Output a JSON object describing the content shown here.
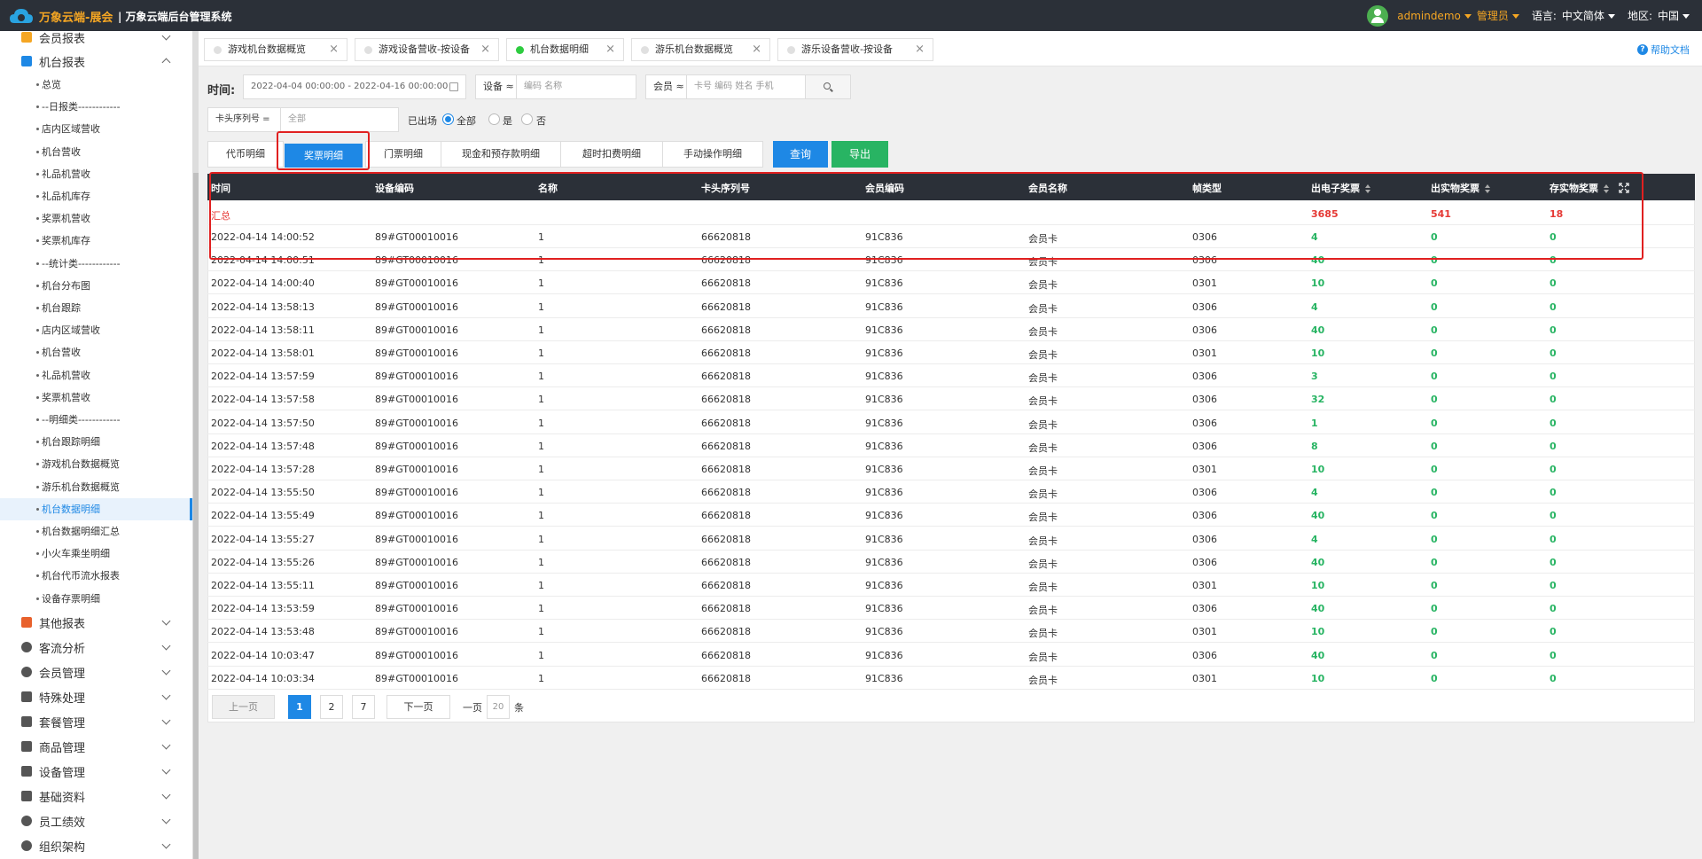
{
  "topbar": {
    "brand": "万象云端-展会",
    "subtitle": "| 万象云端后台管理系统",
    "user": "admindemo",
    "role": "管理员",
    "lang_label": "语言:",
    "lang_value": "中文简体",
    "region_label": "地区:",
    "region_value": "中国"
  },
  "sidebar": {
    "groups_top": [
      {
        "label": "会员报表",
        "icon": "report-icon"
      },
      {
        "label": "机台报表",
        "icon": "machine-report-icon"
      }
    ],
    "items": [
      "总览",
      "--日报类------------",
      "店内区域营收",
      "机台营收",
      "礼品机营收",
      "礼品机库存",
      "奖票机营收",
      "奖票机库存",
      "--统计类------------",
      "机台分布图",
      "机台跟踪",
      "店内区域营收",
      "机台营收",
      "礼品机营收",
      "奖票机营收",
      "--明细类------------",
      "机台跟踪明细",
      "游戏机台数据概览",
      "游乐机台数据概览",
      "机台数据明细",
      "机台数据明细汇总",
      "小火车乘坐明细",
      "机台代币流水报表",
      "设备存票明细"
    ],
    "active_item": "机台数据明细",
    "groups_bottom": [
      {
        "label": "其他报表",
        "icon": "layers-icon"
      },
      {
        "label": "客流分析",
        "icon": "target-icon"
      },
      {
        "label": "会员管理",
        "icon": "user-icon"
      },
      {
        "label": "特殊处理",
        "icon": "warning-icon"
      },
      {
        "label": "套餐管理",
        "icon": "edit-icon"
      },
      {
        "label": "商品管理",
        "icon": "swap-icon"
      },
      {
        "label": "设备管理",
        "icon": "device-icon"
      },
      {
        "label": "基础资料",
        "icon": "document-icon"
      },
      {
        "label": "员工绩效",
        "icon": "gear-icon"
      },
      {
        "label": "组织架构",
        "icon": "org-icon"
      }
    ]
  },
  "tabs": [
    {
      "label": "游戏机台数据概览",
      "active": false
    },
    {
      "label": "游戏设备营收-按设备",
      "active": false
    },
    {
      "label": "机台数据明细",
      "active": true
    },
    {
      "label": "游乐机台数据概览",
      "active": false
    },
    {
      "label": "游乐设备营收-按设备",
      "active": false
    }
  ],
  "help": "帮助文档",
  "filters": {
    "time_label": "时间:",
    "time_value": "2022-04-04 00:00:00 - 2022-04-16 00:00:00",
    "device_prefix": "设备 ≈",
    "device_placeholder": "编码 名称",
    "member_prefix": "会员 ≈",
    "member_placeholder": "卡号 编码 姓名 手机",
    "card_prefix": "卡头序列号 =",
    "card_placeholder": "全部",
    "exited_label": "已出场",
    "opt_all": "全部",
    "opt_yes": "是",
    "opt_no": "否"
  },
  "category_tabs": [
    "代币明细",
    "奖票明细",
    "门票明细",
    "现金和预存款明细",
    "超时扣费明细",
    "手动操作明细"
  ],
  "active_category": "奖票明细",
  "buttons": {
    "query": "查询",
    "export": "导出"
  },
  "table": {
    "columns": [
      "时间",
      "设备编码",
      "名称",
      "卡头序列号",
      "会员编码",
      "会员名称",
      "帧类型",
      "出电子奖票",
      "出实物奖票",
      "存实物奖票"
    ],
    "summary": {
      "label": "汇总",
      "e_ticket": "3685",
      "physical_out": "541",
      "physical_in": "18"
    },
    "rows": [
      [
        "2022-04-14 14:00:52",
        "89#GT00010016",
        "1",
        "66620818",
        "91C836",
        "会员卡",
        "0306",
        "4",
        "0",
        "0"
      ],
      [
        "2022-04-14 14:00:51",
        "89#GT00010016",
        "1",
        "66620818",
        "91C836",
        "会员卡",
        "0306",
        "40",
        "0",
        "0"
      ],
      [
        "2022-04-14 14:00:40",
        "89#GT00010016",
        "1",
        "66620818",
        "91C836",
        "会员卡",
        "0301",
        "10",
        "0",
        "0"
      ],
      [
        "2022-04-14 13:58:13",
        "89#GT00010016",
        "1",
        "66620818",
        "91C836",
        "会员卡",
        "0306",
        "4",
        "0",
        "0"
      ],
      [
        "2022-04-14 13:58:11",
        "89#GT00010016",
        "1",
        "66620818",
        "91C836",
        "会员卡",
        "0306",
        "40",
        "0",
        "0"
      ],
      [
        "2022-04-14 13:58:01",
        "89#GT00010016",
        "1",
        "66620818",
        "91C836",
        "会员卡",
        "0301",
        "10",
        "0",
        "0"
      ],
      [
        "2022-04-14 13:57:59",
        "89#GT00010016",
        "1",
        "66620818",
        "91C836",
        "会员卡",
        "0306",
        "3",
        "0",
        "0"
      ],
      [
        "2022-04-14 13:57:58",
        "89#GT00010016",
        "1",
        "66620818",
        "91C836",
        "会员卡",
        "0306",
        "32",
        "0",
        "0"
      ],
      [
        "2022-04-14 13:57:50",
        "89#GT00010016",
        "1",
        "66620818",
        "91C836",
        "会员卡",
        "0306",
        "1",
        "0",
        "0"
      ],
      [
        "2022-04-14 13:57:48",
        "89#GT00010016",
        "1",
        "66620818",
        "91C836",
        "会员卡",
        "0306",
        "8",
        "0",
        "0"
      ],
      [
        "2022-04-14 13:57:28",
        "89#GT00010016",
        "1",
        "66620818",
        "91C836",
        "会员卡",
        "0301",
        "10",
        "0",
        "0"
      ],
      [
        "2022-04-14 13:55:50",
        "89#GT00010016",
        "1",
        "66620818",
        "91C836",
        "会员卡",
        "0306",
        "4",
        "0",
        "0"
      ],
      [
        "2022-04-14 13:55:49",
        "89#GT00010016",
        "1",
        "66620818",
        "91C836",
        "会员卡",
        "0306",
        "40",
        "0",
        "0"
      ],
      [
        "2022-04-14 13:55:27",
        "89#GT00010016",
        "1",
        "66620818",
        "91C836",
        "会员卡",
        "0306",
        "4",
        "0",
        "0"
      ],
      [
        "2022-04-14 13:55:26",
        "89#GT00010016",
        "1",
        "66620818",
        "91C836",
        "会员卡",
        "0306",
        "40",
        "0",
        "0"
      ],
      [
        "2022-04-14 13:55:11",
        "89#GT00010016",
        "1",
        "66620818",
        "91C836",
        "会员卡",
        "0301",
        "10",
        "0",
        "0"
      ],
      [
        "2022-04-14 13:53:59",
        "89#GT00010016",
        "1",
        "66620818",
        "91C836",
        "会员卡",
        "0306",
        "40",
        "0",
        "0"
      ],
      [
        "2022-04-14 13:53:48",
        "89#GT00010016",
        "1",
        "66620818",
        "91C836",
        "会员卡",
        "0301",
        "10",
        "0",
        "0"
      ],
      [
        "2022-04-14 10:03:47",
        "89#GT00010016",
        "1",
        "66620818",
        "91C836",
        "会员卡",
        "0306",
        "40",
        "0",
        "0"
      ],
      [
        "2022-04-14 10:03:34",
        "89#GT00010016",
        "1",
        "66620818",
        "91C836",
        "会员卡",
        "0301",
        "10",
        "0",
        "0"
      ]
    ]
  },
  "pagination": {
    "prev": "上一页",
    "pages": [
      "1",
      "2",
      "7"
    ],
    "current": "1",
    "next": "下一页",
    "per_page_label": "一页",
    "per_page_value": "20",
    "per_page_unit": "条"
  },
  "colors": {
    "topbar": "#2b3038",
    "accent": "#1e88e5",
    "brand": "#f5a623",
    "positive": "#28b463",
    "summary": "#e53935",
    "highlight": "#e02020"
  }
}
